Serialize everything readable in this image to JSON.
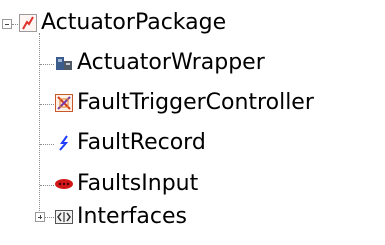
{
  "tree": {
    "root": {
      "label": "ActuatorPackage",
      "icon": "package-icon"
    },
    "children": [
      {
        "label": "ActuatorWrapper",
        "icon": "wrapper-icon"
      },
      {
        "label": "FaultTriggerController",
        "icon": "controller-icon"
      },
      {
        "label": "FaultRecord",
        "icon": "lightning-icon"
      },
      {
        "label": "FaultsInput",
        "icon": "input-icon"
      },
      {
        "label": "Interfaces",
        "icon": "interface-icon"
      }
    ]
  },
  "colors": {
    "package_accent": "#e0322c",
    "lightning": "#1f3cff",
    "input": "#d01818",
    "connector": "#8a8a8a"
  }
}
